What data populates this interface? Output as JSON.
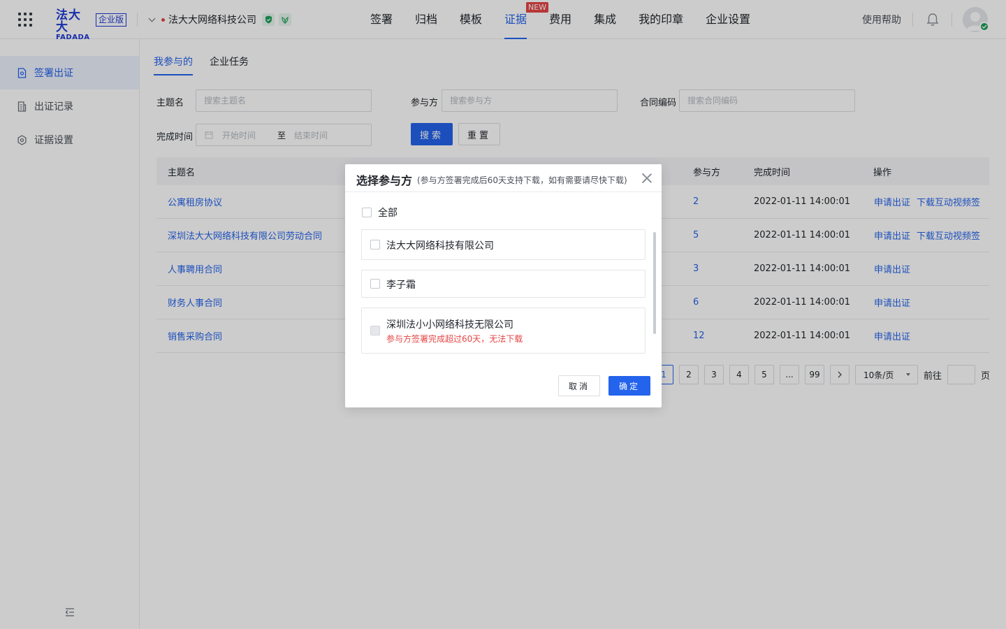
{
  "header": {
    "logo_cn": "法大大",
    "logo_en": "FADADA",
    "edition": "企业版",
    "company": "法大大网络科技公司",
    "nav": [
      {
        "label": "签署"
      },
      {
        "label": "归档"
      },
      {
        "label": "模板"
      },
      {
        "label": "证据",
        "tag": "NEW"
      },
      {
        "label": "费用"
      },
      {
        "label": "集成"
      },
      {
        "label": "我的印章"
      },
      {
        "label": "企业设置"
      }
    ],
    "help": "使用帮助"
  },
  "sidebar": {
    "items": [
      {
        "label": "签署出证",
        "icon": "doc-certificate-icon"
      },
      {
        "label": "出证记录",
        "icon": "record-list-icon"
      },
      {
        "label": "证据设置",
        "icon": "gear-icon"
      }
    ]
  },
  "tabs": [
    "我参与的",
    "企业任务"
  ],
  "filters": {
    "subject_label": "主题名",
    "subject_placeholder": "搜索主题名",
    "party_label": "参与方",
    "party_placeholder": "搜索参与方",
    "code_label": "合同编码",
    "code_placeholder": "搜索合同编码",
    "time_label": "完成时间",
    "start_placeholder": "开始时间",
    "to": "至",
    "end_placeholder": "结束时间",
    "search_btn": "搜索",
    "reset_btn": "重置"
  },
  "table": {
    "headers": {
      "subject": "主题名",
      "parties": "参与方",
      "time": "完成时间",
      "ops": "操作"
    },
    "rows": [
      {
        "subject": "公寓租房协议",
        "parties": "2",
        "time": "2022-01-11 14:00:01",
        "ops": [
          "申请出证",
          "下载互动视频签"
        ]
      },
      {
        "subject": "深圳法大大网络科技有限公司劳动合同",
        "parties": "5",
        "time": "2022-01-11 14:00:01",
        "ops": [
          "申请出证",
          "下载互动视频签"
        ]
      },
      {
        "subject": "人事聘用合同",
        "parties": "3",
        "time": "2022-01-11 14:00:01",
        "ops": [
          "申请出证"
        ]
      },
      {
        "subject": "财务人事合同",
        "parties": "6",
        "time": "2022-01-11 14:00:01",
        "ops": [
          "申请出证"
        ]
      },
      {
        "subject": "销售采购合同",
        "parties": "12",
        "time": "2022-01-11 14:00:01",
        "ops": [
          "申请出证"
        ]
      }
    ]
  },
  "pagination": {
    "pages": [
      "1",
      "2",
      "3",
      "4",
      "5",
      "...",
      "99"
    ],
    "current": "1",
    "page_size": "10条/页",
    "goto_label": "前往",
    "page_unit": "页"
  },
  "modal": {
    "title": "选择参与方",
    "subtitle": "(参与方签署完成后60天支持下载，如有需要请尽快下载)",
    "check_all": "全部",
    "parties": [
      {
        "name": "法大大网络科技有限公司",
        "disabled": false
      },
      {
        "name": "李子霜",
        "disabled": false
      },
      {
        "name": "深圳法小小网络科技无限公司",
        "disabled": true,
        "note": "参与方签署完成超过60天，无法下载"
      }
    ],
    "cancel": "取消",
    "ok": "确定"
  },
  "colors": {
    "primary": "#2463eb",
    "danger": "#e54545",
    "success": "#1e9e5a"
  }
}
